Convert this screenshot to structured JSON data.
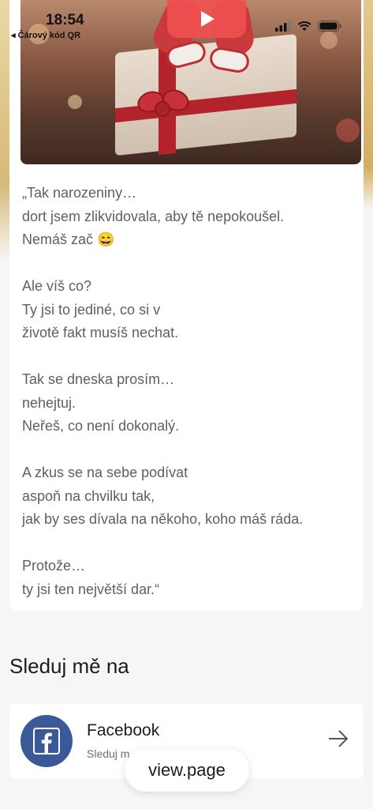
{
  "status_bar": {
    "time": "18:54",
    "back_app": "◂ Čárový kód QR",
    "icons": [
      "signal-icon",
      "wifi-icon",
      "battery-icon"
    ]
  },
  "media": {
    "play_icon": "play-icon"
  },
  "post": {
    "text": "„Tak narozeniny…\ndort jsem zlikvidovala, aby tě nepokoušel.\nNemáš zač 😄\n\nAle víš co?\nTy jsi to jediné, co si v\nživotě fakt musíš nechat.\n\nTak se dneska prosím…\nnehejtuj.\nNeřeš, co není dokonalý.\n\nA zkus se na sebe podívat\naspoň na chvilku tak,\njak by ses dívala na někoho, koho máš ráda.\n\nProtože…\nty jsi ten největší dar.“"
  },
  "follow": {
    "title": "Sleduj mě na",
    "facebook": {
      "name": "Facebook",
      "subtitle": "Sleduj m",
      "logo_letter": "f"
    }
  },
  "badge": {
    "label": "view.page"
  },
  "colors": {
    "facebook_blue": "#3b5998",
    "accent_gold": "#d6b978",
    "play_red": "#f05050"
  }
}
